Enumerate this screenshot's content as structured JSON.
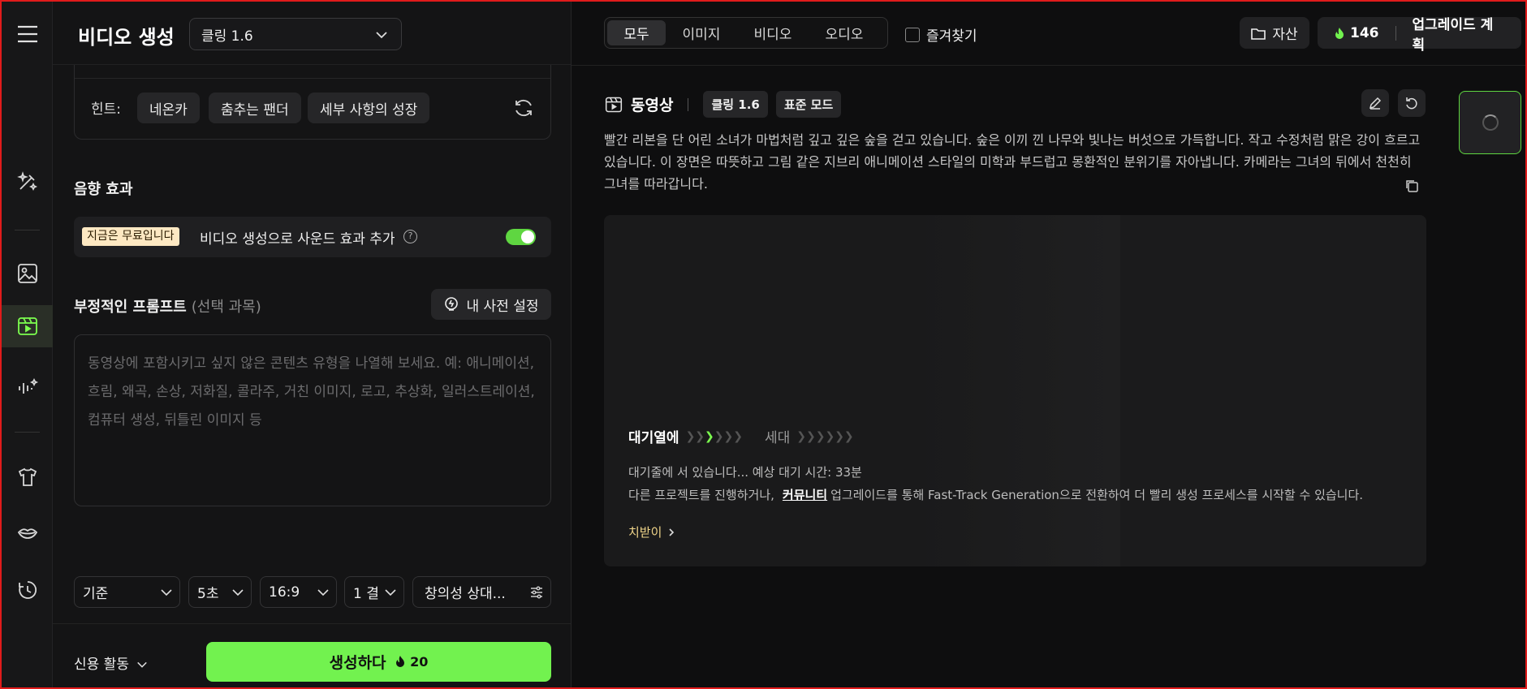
{
  "left": {
    "title": "비디오 생성",
    "model_value": "클링 1.6",
    "hint_label": "힌트:",
    "hints": [
      "네온카",
      "춤추는 팬더",
      "세부 사항의 성장"
    ],
    "sound_section_title": "음향 효과",
    "free_badge": "지금은 무료입니다",
    "sound_label": "비디오 생성으로 사운드 효과 추가",
    "sound_enabled": true,
    "negative_title": "부정적인 프롬프트",
    "negative_optional": "(선택 과목)",
    "dictionary_button": "내 사전 설정",
    "negative_placeholder": "동영상에 포함시키고 싶지 않은 콘텐츠 유형을 나열해 보세요. 예: 애니메이션, 흐림, 왜곡, 손상, 저화질, 콜라주, 거친 이미지, 로고, 추상화, 일러스트레이션, 컴퓨터 생성, 뒤틀린 이미지 등",
    "params": {
      "mode": "기준",
      "duration": "5초",
      "ratio": "16:9",
      "count": "1 결",
      "creativity": "창의성 상대..."
    },
    "credit_menu": "신용 활동",
    "generate_label": "생성하다",
    "generate_cost": "20"
  },
  "topbar": {
    "filter_tabs": [
      "모두",
      "이미지",
      "비디오",
      "오디오"
    ],
    "active_filter": "모두",
    "favorites": "즐겨찾기",
    "assets": "자산",
    "credits": "146",
    "upgrade": "업그레이드 계획"
  },
  "card": {
    "title": "동영상",
    "model_tag": "클링 1.6",
    "mode_tag": "표준 모드",
    "description": "빨간 리본을 단 어린 소녀가 마법처럼 깊고 깊은 숲을 걷고 있습니다. 숲은 이끼 낀 나무와 빛나는 버섯으로 가득합니다. 작고 수정처럼 맑은 강이 흐르고 있습니다. 이 장면은 따뜻하고 그림 같은 지브리 애니메이션 스타일의 미학과 부드럽고 몽환적인 분위기를 자아냅니다. 카메라는 그녀의 뒤에서 천천히 그녀를 따라갑니다.",
    "queue_stage": "대기열에",
    "gen_stage": "세대",
    "queue_status": "대기줄에 서 있습니다... 예상 대기 시간: 33분",
    "queue_info_pre": "다른 프로젝트를 진행하거나,",
    "queue_link": "커뮤니티",
    "queue_info_post": "업그레이드를 통해 Fast-Track Generation으로 전환하여 더 빨리 생성 프로세스를 시작할 수 있습니다.",
    "tip": "치받이"
  },
  "icons": [
    "menu-icon",
    "magic-wand-icon",
    "image-icon",
    "video-icon",
    "audio-icon",
    "shirt-icon",
    "lips-icon",
    "history-icon",
    "refresh-icon",
    "bulb-icon",
    "sliders-icon",
    "flame-icon",
    "folder-icon",
    "edit-icon",
    "undo-icon",
    "copy-icon",
    "film-icon",
    "chevron-down-icon",
    "chevron-right-icon"
  ],
  "colors": {
    "accent": "#72f24f",
    "badge": "#fde8c2",
    "tip": "#f0d58a"
  }
}
